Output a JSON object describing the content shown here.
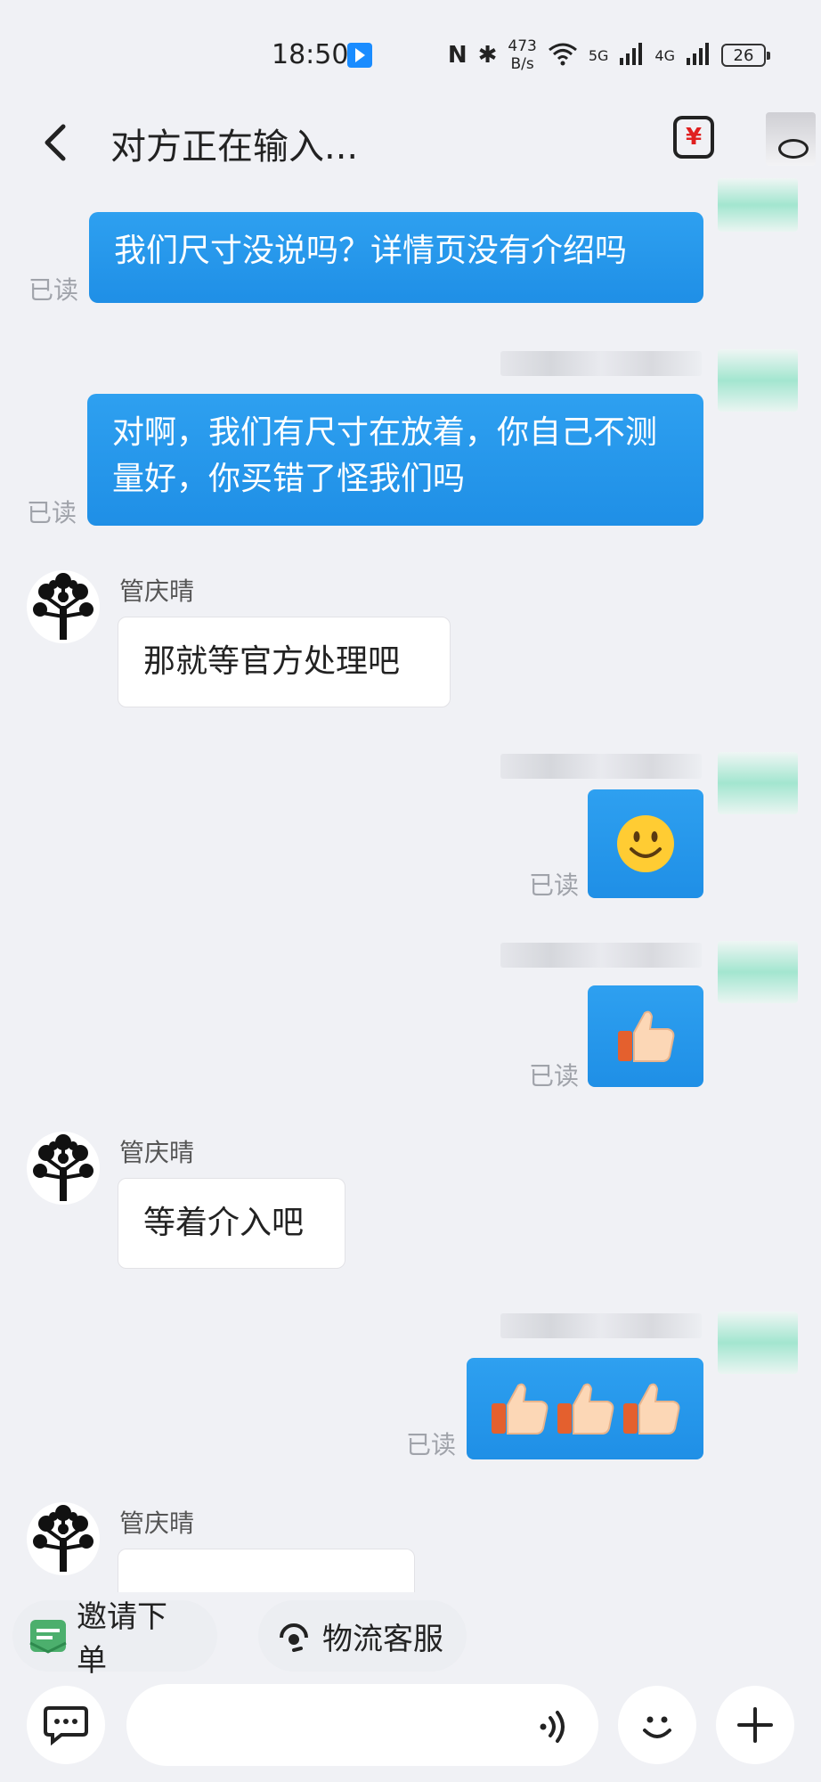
{
  "status": {
    "time": "18:50",
    "net_speed_value": "473",
    "net_speed_unit": "B/s",
    "signal_1": "5G",
    "signal_2": "4G",
    "battery": "26"
  },
  "header": {
    "title": "对方正在输入..."
  },
  "messages": {
    "m1": {
      "text": "我们尺寸没说吗？详情页没有介绍吗",
      "status": "已读"
    },
    "m2": {
      "text": "对啊，我们有尺寸在放着，你自己不测量好，你买错了怪我们吗",
      "status": "已读"
    },
    "m3": {
      "sender": "管庆晴",
      "text": "那就等官方处理吧"
    },
    "m4": {
      "emoji": "🙂",
      "status": "已读"
    },
    "m5": {
      "emoji": "👍",
      "status": "已读"
    },
    "m6": {
      "sender": "管庆晴",
      "text": "等着介入吧"
    },
    "m7": {
      "emoji": "👍👍👍",
      "status": "已读"
    },
    "m8": {
      "sender": "管庆晴"
    }
  },
  "quick_actions": {
    "invite_order": "邀请下单",
    "logistics_service": "物流客服"
  },
  "input": {
    "placeholder": ""
  },
  "colors": {
    "outgoing_bubble": "#1f8fe6",
    "page_bg": "#f0f1f5",
    "invite_icon": "#4caf6d"
  }
}
